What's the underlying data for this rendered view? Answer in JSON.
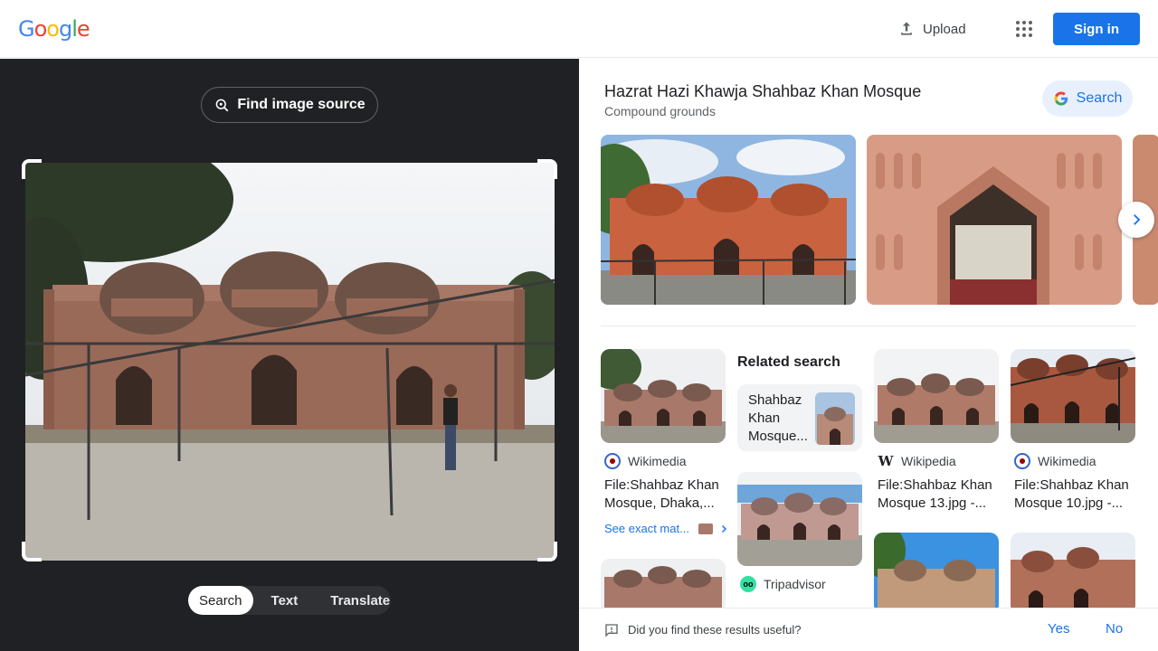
{
  "header": {
    "logo": [
      "G",
      "o",
      "o",
      "g",
      "l",
      "e"
    ],
    "logo_colors": [
      "#4285F4",
      "#EA4335",
      "#FBBC05",
      "#4285F4",
      "#34A853",
      "#EA4335"
    ],
    "upload_label": "Upload",
    "signin_label": "Sign in"
  },
  "left": {
    "find_source_label": "Find image source",
    "modes": [
      "Search",
      "Text",
      "Translate"
    ],
    "active_mode": "Search"
  },
  "right": {
    "title": "Hazrat Hazi Khawja Shahbaz Khan Mosque",
    "subtitle": "Compound grounds",
    "search_label": "Search",
    "related_heading": "Related search",
    "related_query": "Shahbaz Khan Mosque...",
    "results": [
      {
        "source": "Wikimedia",
        "caption": "File:Shahbaz Khan Mosque, Dhaka,..."
      },
      {
        "source": "Wikipedia",
        "caption": "File:Shahbaz Khan Mosque 13.jpg -..."
      },
      {
        "source": "Wikimedia",
        "caption": "File:Shahbaz Khan Mosque 10.jpg -..."
      },
      {
        "source": "Tripadvisor",
        "caption": ""
      }
    ],
    "see_exact_label": "See exact mat..."
  },
  "feedback": {
    "question": "Did you find these results useful?",
    "yes_label": "Yes",
    "no_label": "No"
  },
  "colors": {
    "accent": "#1a73e8",
    "left_bg": "#202124"
  }
}
